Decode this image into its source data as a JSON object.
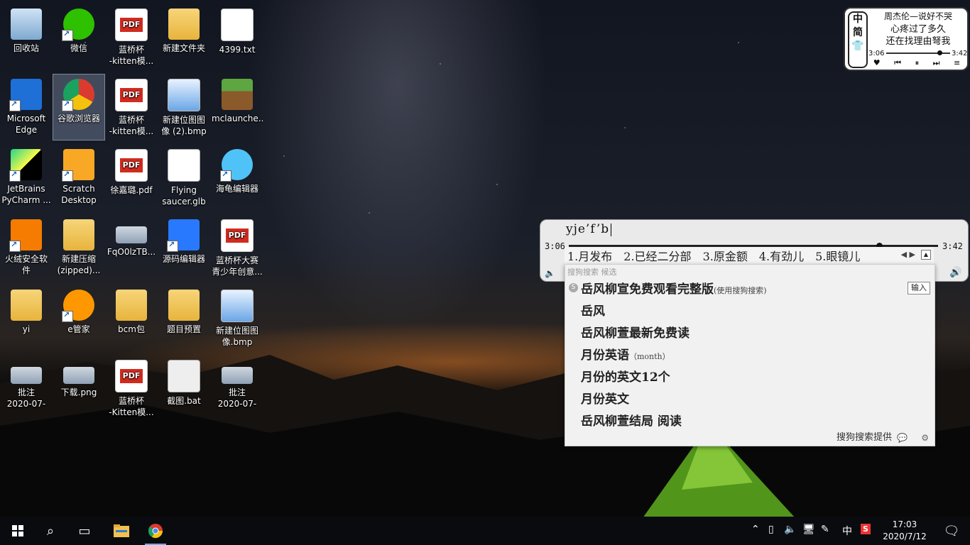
{
  "desktop": {
    "icons": [
      {
        "label": "回收站",
        "icon": "recycle-bin-icon"
      },
      {
        "label": "微信",
        "icon": "wechat-icon"
      },
      {
        "label": "蓝桥杯\n-kitten模...",
        "icon": "pdf-icon"
      },
      {
        "label": "新建文件夹",
        "icon": "folder-icon"
      },
      {
        "label": "4399.txt",
        "icon": "text-file-icon"
      },
      {
        "label": "Microsoft\nEdge",
        "icon": "edge-icon"
      },
      {
        "label": "谷歌浏览器",
        "icon": "chrome-icon"
      },
      {
        "label": "蓝桥杯\n-kitten模...",
        "icon": "pdf-icon"
      },
      {
        "label": "新建位图图\n像 (2).bmp",
        "icon": "image-file-icon"
      },
      {
        "label": "mclaunche...",
        "icon": "minecraft-icon"
      },
      {
        "label": "JetBrains\nPyCharm ...",
        "icon": "pycharm-icon"
      },
      {
        "label": "Scratch\nDesktop",
        "icon": "scratch-icon"
      },
      {
        "label": "徐嘉璐.pdf",
        "icon": "pdf-icon"
      },
      {
        "label": "Flying\nsaucer.glb",
        "icon": "3d-model-icon"
      },
      {
        "label": "海龟编辑器",
        "icon": "turtle-editor-icon"
      },
      {
        "label": "火绒安全软\n件",
        "icon": "huorong-icon"
      },
      {
        "label": "新建压缩\n(zipped)...",
        "icon": "zip-folder-icon"
      },
      {
        "label": "FqO0lzTB...",
        "icon": "image-thumbnail-icon"
      },
      {
        "label": "源码编辑器",
        "icon": "code-editor-icon"
      },
      {
        "label": "蓝桥杯大赛\n青少年创意...",
        "icon": "pdf-icon"
      },
      {
        "label": "yi",
        "icon": "folder-icon"
      },
      {
        "label": "e管家",
        "icon": "e-manager-icon"
      },
      {
        "label": "bcm包",
        "icon": "folder-icon"
      },
      {
        "label": "题目预置",
        "icon": "folder-icon"
      },
      {
        "label": "新建位图图\n像.bmp",
        "icon": "image-file-icon"
      },
      {
        "label": "批注\n2020-07-0...",
        "icon": "image-thumbnail-icon"
      },
      {
        "label": "下载.png",
        "icon": "image-thumbnail-icon"
      },
      {
        "label": "蓝桥杯\n-Kitten模...",
        "icon": "pdf-icon"
      },
      {
        "label": "截图.bat",
        "icon": "batch-file-icon"
      },
      {
        "label": "批注\n2020-07-0...",
        "icon": "image-thumbnail-icon"
      }
    ]
  },
  "music_widget": {
    "badge_top": "中",
    "badge_mid": "简",
    "lyric1": "周杰伦—说好不哭",
    "lyric2": "心疼过了多久",
    "lyric3": "还在找理由弩我",
    "time_current": "3:06",
    "time_total": "3:42",
    "progress": 0.83
  },
  "player": {
    "time_current": "3:06",
    "time_total": "3:42",
    "progress": 0.84
  },
  "ime": {
    "composition": "yje’f’b",
    "candidates": [
      "1.月发布",
      "2.已经二分部",
      "3.原金额",
      "4.有劲儿",
      "5.眼镜儿"
    ],
    "panel_header": "搜狗搜索  候选",
    "suggestions": [
      {
        "text": "岳风柳宣免费观看完整版",
        "note": "(使用搜狗搜索)"
      },
      {
        "text": "岳风",
        "note": ""
      },
      {
        "text": "岳风柳萱最新免费读",
        "note": ""
      },
      {
        "text": "月份英语",
        "note": "（month）"
      },
      {
        "text": "月份的英文12个",
        "note": ""
      },
      {
        "text": "月份英文",
        "note": ""
      },
      {
        "text": "岳风柳萱结局 阅读",
        "note": ""
      }
    ],
    "input_button": "输入",
    "footer": "搜狗搜索提供"
  },
  "taskbar": {
    "time": "17:03",
    "date": "2020/7/12",
    "ime_mode": "中",
    "colors": {
      "accent": "#7aa7e0",
      "background": "#0a0b0f"
    }
  }
}
